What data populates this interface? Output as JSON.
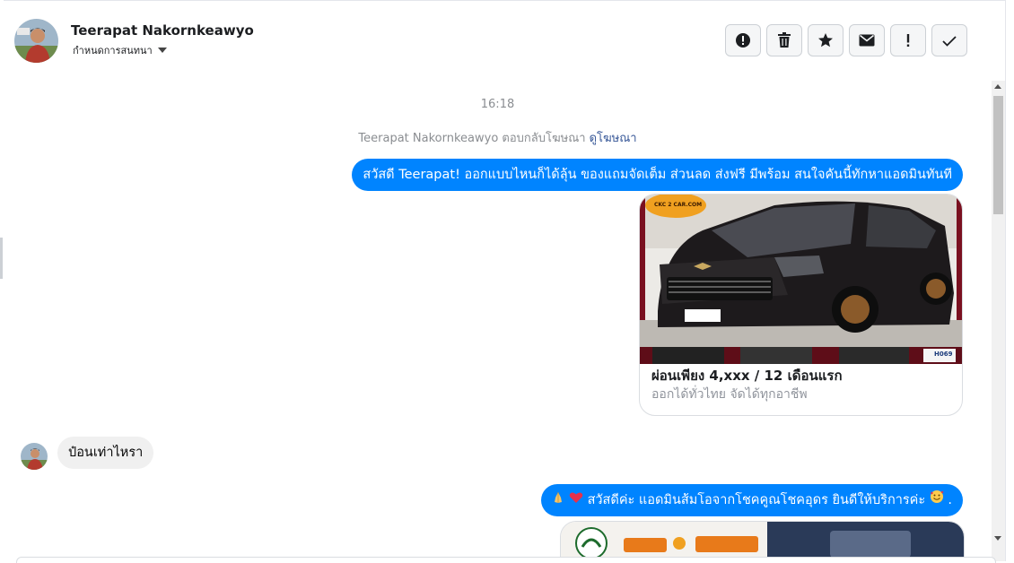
{
  "header": {
    "contact_name": "Teerapat Nakornkeawyo",
    "assign_label": "กำหนดการสนทนา",
    "toolbar": [
      {
        "icon": "alert-circle-icon",
        "name": "mark-spam-button"
      },
      {
        "icon": "trash-icon",
        "name": "delete-button"
      },
      {
        "icon": "star-icon",
        "name": "star-button"
      },
      {
        "icon": "envelope-icon",
        "name": "mark-unread-button"
      },
      {
        "icon": "exclamation-icon",
        "name": "flag-button"
      },
      {
        "icon": "check-icon",
        "name": "mark-done-button"
      }
    ]
  },
  "conversation": {
    "timestamp": "16:18",
    "system_text": "Teerapat Nakornkeawyo ตอบกลับโฆษณา",
    "system_link": "ดูโฆษณา",
    "message_out_1": "สวัสดี Teerapat! ออกแบบไหนก็ได้ลุ้น ของแถมจัดเต็ม ส่วนลด ส่งฟรี มีพร้อม สนใจคันนี้ทักหาแอดมินทันที",
    "ad_card": {
      "title": "ผ่อนเพียง 4,xxx / 12 เดือนแรก",
      "subtitle": "ออกได้ทั่วไทย จัดได้ทุกอาชีพ",
      "logo_text": "CKC 2 CAR.COM",
      "badge": "H069"
    },
    "message_in_1": "ป๋อนเท่าไหรา",
    "message_out_2": "สวัสดีค่ะ แอดมินส้มโอจากโชคคูณโชคอุดร ยินดีให้บริการค่ะ",
    "message_out_2_suffix": "."
  },
  "colors": {
    "outgoing_bubble": "#0084ff",
    "incoming_bubble": "#f0f0f0",
    "link": "#385898"
  }
}
